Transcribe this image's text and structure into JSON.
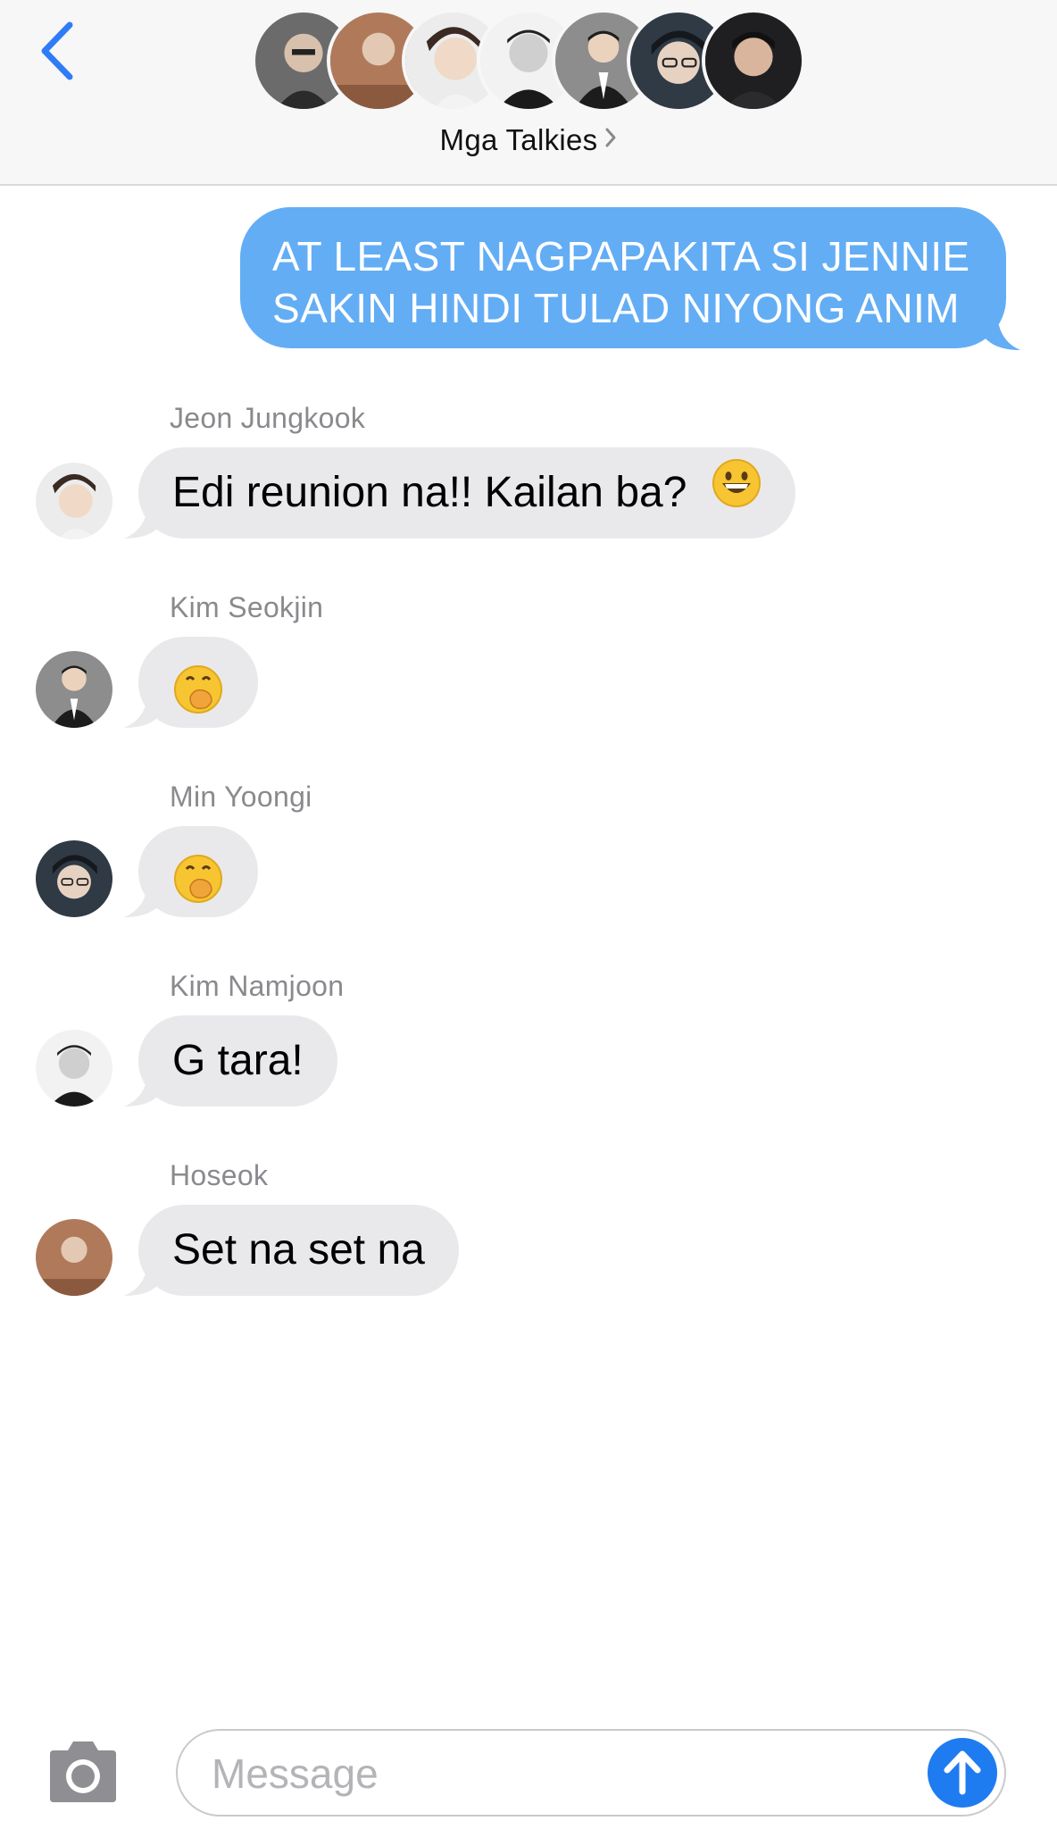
{
  "header": {
    "back_icon": "chevron-left-icon",
    "group_name": "Mga Talkies",
    "accent": "#2f7cf6"
  },
  "messages": {
    "outgoing_text_line1": "AT LEAST NAGPAPAKITA SI JENNIE",
    "outgoing_text_line2": "SAKIN HINDI TULAD NIYONG ANIM",
    "incoming": [
      {
        "sender": "Jeon Jungkook",
        "text": "Edi reunion na!! Kailan ba?",
        "emoji": "grinning-face"
      },
      {
        "sender": "Kim Seokjin",
        "text": "",
        "emoji": "face-with-hand-over-mouth"
      },
      {
        "sender": "Min Yoongi",
        "text": "",
        "emoji": "face-with-hand-over-mouth"
      },
      {
        "sender": "Kim Namjoon",
        "text": "G tara!"
      },
      {
        "sender": "Hoseok",
        "text": "Set na set na"
      }
    ]
  },
  "input_bar": {
    "placeholder": "Message",
    "camera_icon": "camera-icon",
    "send_icon": "arrow-up-icon"
  },
  "colors": {
    "outgoing_bubble": "#63adf5",
    "incoming_bubble": "#e9e9eb",
    "send_button": "#1f7bf0"
  }
}
